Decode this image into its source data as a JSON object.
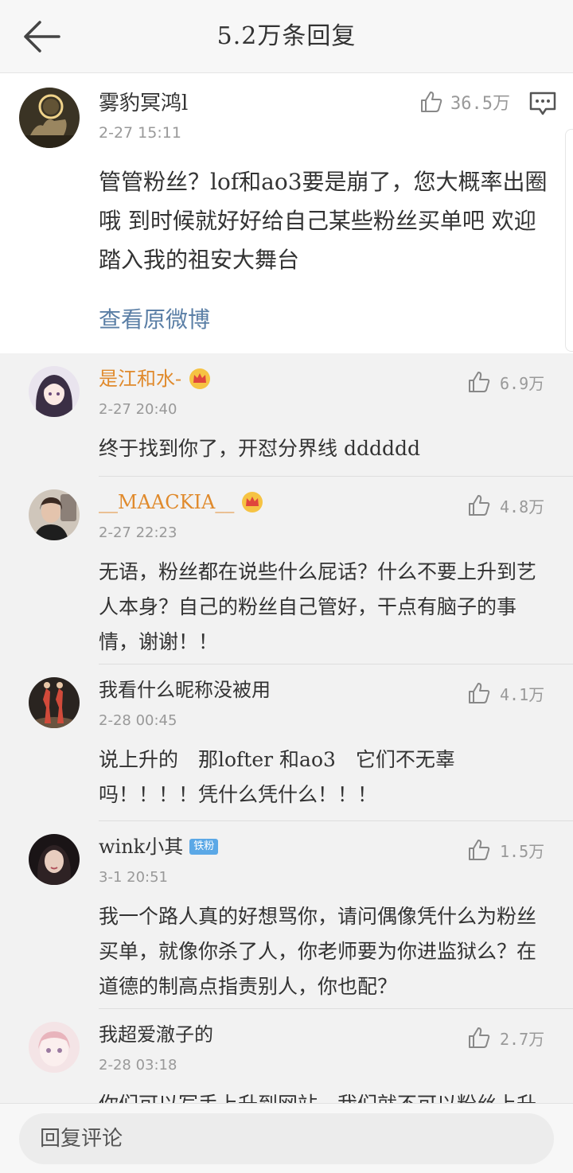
{
  "header": {
    "title": "5.2万条回复",
    "back_icon": "back-arrow-icon"
  },
  "main_comment": {
    "username": "雾豹冥鸿l",
    "time": "2-27 15:11",
    "likes": "36.5万",
    "content": "管管粉丝？lof和ao3要是崩了，您大概率出圈哦 到时候就好好给自己某些粉丝买单吧 欢迎踏入我的祖安大舞台",
    "view_original": "查看原微博",
    "more_icon": "more-icon"
  },
  "replies": [
    {
      "username": "是江和水-",
      "vip": true,
      "badge": "",
      "time": "2-27 20:40",
      "likes": "6.9万",
      "content": "终于找到你了，开怼分界线 dddddd"
    },
    {
      "username": "__MAACKIA__",
      "vip": true,
      "badge": "",
      "time": "2-27 22:23",
      "likes": "4.8万",
      "content": "无语，粉丝都在说些什么屁话？什么不要上升到艺人本身？自己的粉丝自己管好，干点有脑子的事情，谢谢！！"
    },
    {
      "username": "我看什么昵称没被用",
      "vip": false,
      "badge": "",
      "time": "2-28 00:45",
      "likes": "4.1万",
      "content": "说上升的　那lofter 和ao3　它们不无辜吗！！！！凭什么凭什么！！！"
    },
    {
      "username": "wink小其",
      "vip": false,
      "badge": "铁粉",
      "time": "3-1 20:51",
      "likes": "1.5万",
      "content": "我一个路人真的好想骂你，请问偶像凭什么为粉丝买单，就像你杀了人，你老师要为你进监狱么？在道德的制高点指责别人，你也配？"
    },
    {
      "username": "我超爱澈子的",
      "vip": false,
      "badge": "",
      "time": "2-28 03:18",
      "likes": "2.7万",
      "content": "你们可以写手上升到网站，我们就不可以粉丝上升到艺人"
    }
  ],
  "bottom_bar": {
    "placeholder": "回复评论"
  },
  "colors": {
    "link": "#5b7fa6",
    "vip_name": "#e08a2c",
    "badge": "#5ba8e6",
    "background": "#f2f2f2"
  }
}
